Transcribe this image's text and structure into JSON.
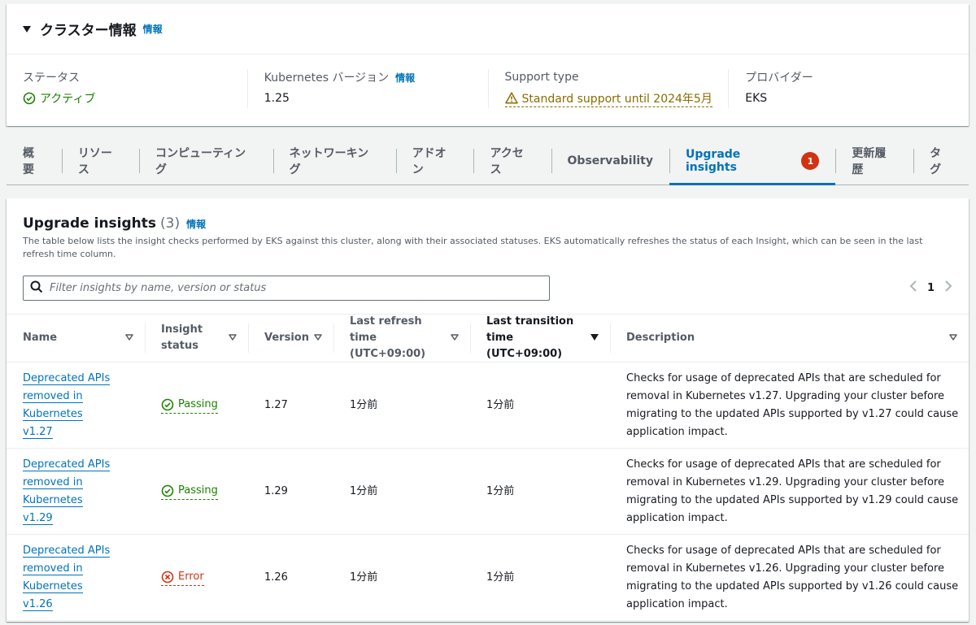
{
  "cluster": {
    "title": "クラスター情報",
    "info_label": "情報",
    "status": {
      "label": "ステータス",
      "value": "アクティブ"
    },
    "k8s": {
      "label": "Kubernetes バージョン",
      "info_label": "情報",
      "value": "1.25"
    },
    "support": {
      "label": "Support type",
      "value": "Standard support until 2024年5月"
    },
    "provider": {
      "label": "プロバイダー",
      "value": "EKS"
    }
  },
  "tabs": [
    {
      "label": "概要"
    },
    {
      "label": "リソース"
    },
    {
      "label": "コンピューティング"
    },
    {
      "label": "ネットワーキング"
    },
    {
      "label": "アドオン"
    },
    {
      "label": "アクセス"
    },
    {
      "label": "Observability"
    },
    {
      "label": "Upgrade insights",
      "badge": "1",
      "active": true
    },
    {
      "label": "更新履歴"
    },
    {
      "label": "タグ"
    }
  ],
  "insights": {
    "title": "Upgrade insights",
    "count": "(3)",
    "info_label": "情報",
    "description": "The table below lists the insight checks performed by EKS against this cluster, along with their associated statuses. EKS automatically refreshes the status of each Insight, which can be seen in the last refresh time column.",
    "filter_placeholder": "Filter insights by name, version or status",
    "page": "1",
    "columns": {
      "name": "Name",
      "status": "Insight status",
      "version": "Version",
      "refresh": "Last refresh time (UTC+09:00)",
      "transition": "Last transition time (UTC+09:00)",
      "description": "Description"
    },
    "rows": [
      {
        "name": "Deprecated APIs removed in Kubernetes v1.27",
        "status": "Passing",
        "version": "1.27",
        "refresh": "1分前",
        "transition": "1分前",
        "description": "Checks for usage of deprecated APIs that are scheduled for removal in Kubernetes v1.27. Upgrading your cluster before migrating to the updated APIs supported by v1.27 could cause application impact."
      },
      {
        "name": "Deprecated APIs removed in Kubernetes v1.29",
        "status": "Passing",
        "version": "1.29",
        "refresh": "1分前",
        "transition": "1分前",
        "description": "Checks for usage of deprecated APIs that are scheduled for removal in Kubernetes v1.29. Upgrading your cluster before migrating to the updated APIs supported by v1.29 could cause application impact."
      },
      {
        "name": "Deprecated APIs removed in Kubernetes v1.26",
        "status": "Error",
        "version": "1.26",
        "refresh": "1分前",
        "transition": "1分前",
        "description": "Checks for usage of deprecated APIs that are scheduled for removal in Kubernetes v1.26. Upgrading your cluster before migrating to the updated APIs supported by v1.26 could cause application impact."
      }
    ]
  }
}
